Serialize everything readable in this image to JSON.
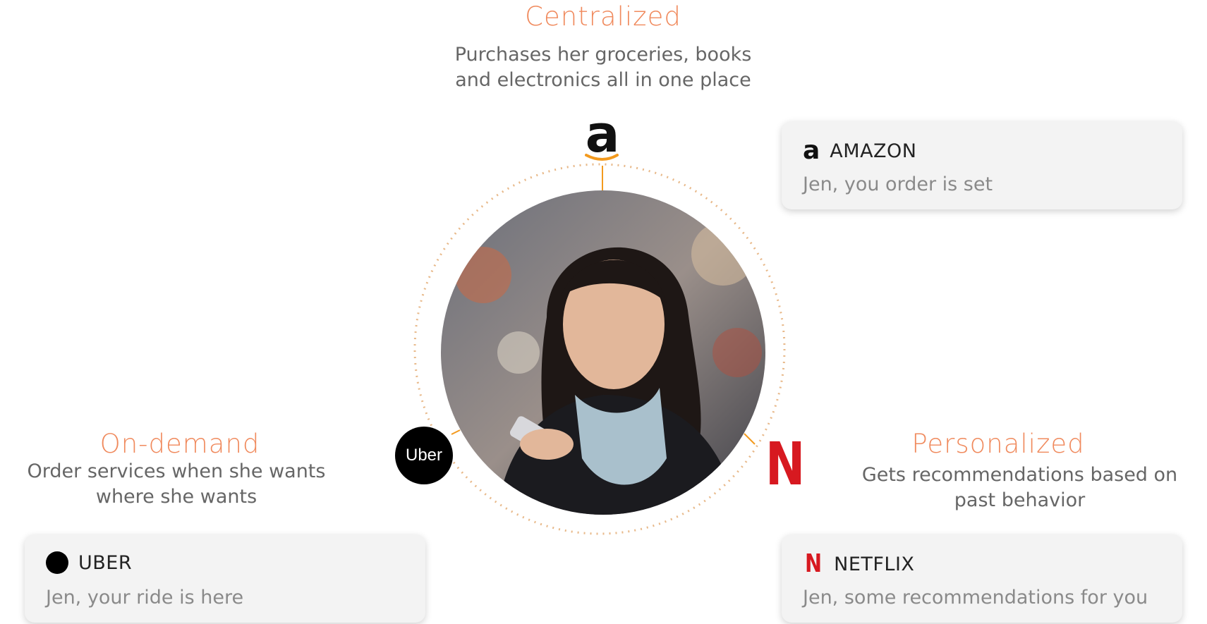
{
  "centralized": {
    "heading": "Centralized",
    "line1": "Purchases her groceries, books",
    "line2": "and electronics all in one place"
  },
  "on_demand": {
    "heading": "On-demand",
    "line1": "Order services when she wants",
    "line2": "where she wants"
  },
  "personalized": {
    "heading": "Personalized",
    "line1": "Gets recommendations based on",
    "line2": "past behavior"
  },
  "cards": {
    "amazon": {
      "brand": "AMAZON",
      "message": "Jen, you order is set"
    },
    "uber": {
      "brand": "UBER",
      "message": "Jen, your ride is here"
    },
    "netflix": {
      "brand": "NETFLIX",
      "message": "Jen, some recommendations for you"
    }
  },
  "orbit_icons": {
    "amazon_glyph": "a",
    "uber_text": "Uber",
    "netflix_glyph": "N"
  },
  "colors": {
    "heading_accent": "#f08a5d",
    "netflix_red": "#d71920",
    "amazon_orange": "#f39a1e"
  }
}
